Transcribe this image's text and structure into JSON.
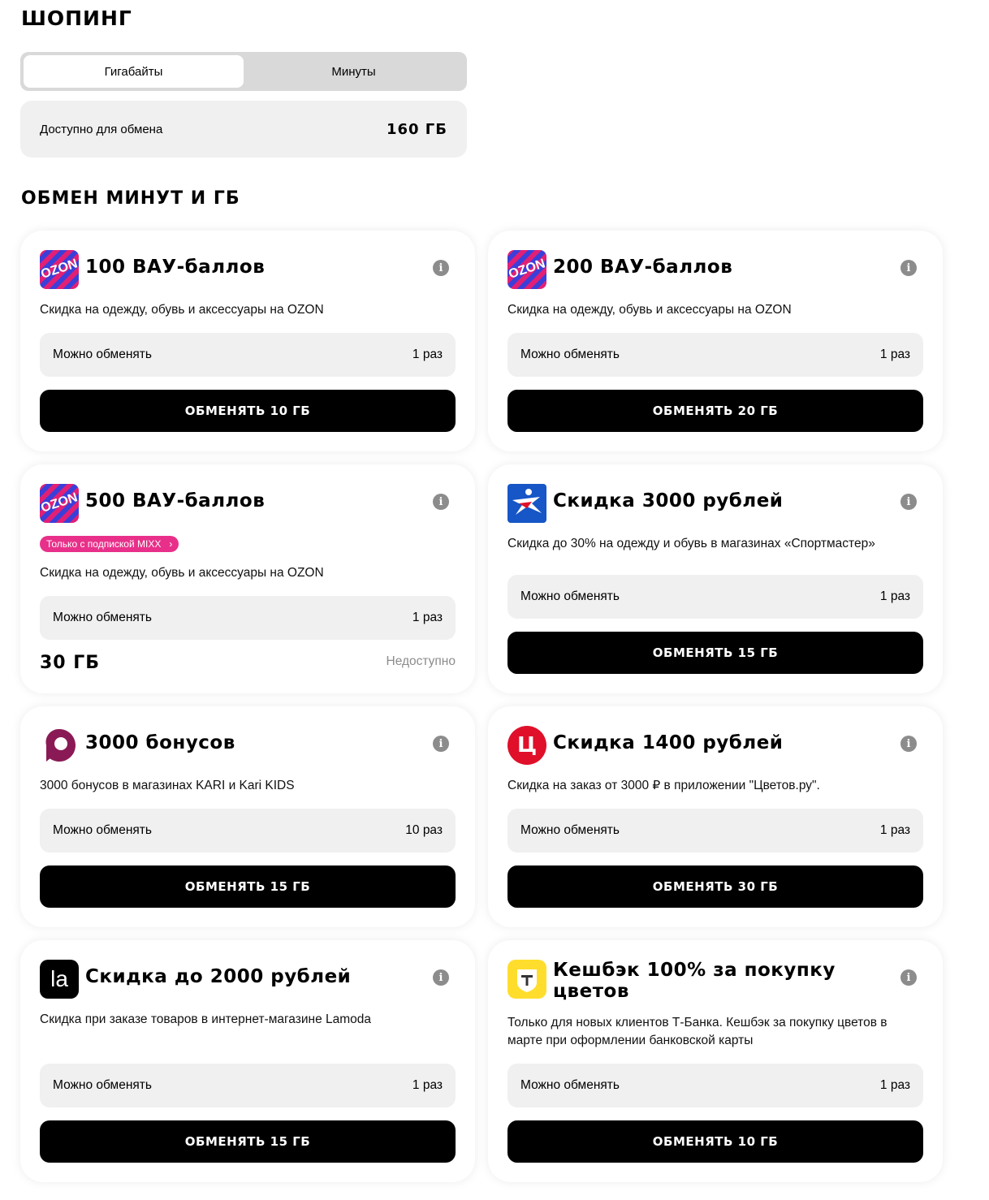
{
  "page": {
    "title": "ШОПИНГ",
    "tabs": [
      {
        "label": "Гигабайты",
        "active": true
      },
      {
        "label": "Минуты",
        "active": false
      }
    ],
    "available": {
      "label": "Доступно для обмена",
      "value": "160 ГБ"
    },
    "section_title": "ОБМЕН МИНУТ И ГБ"
  },
  "common": {
    "count_label": "Можно обменять",
    "info_glyph": "i"
  },
  "cards": [
    {
      "logo": "ozon-logo",
      "logo_text": "OZON",
      "title": "100 ВАУ-баллов",
      "desc": "Скидка на одежду, обувь и аксессуары на OZON",
      "count": "1 раз",
      "button": "ОБМЕНЯТЬ 10 ГБ"
    },
    {
      "logo": "ozon-logo",
      "logo_text": "OZON",
      "title": "200 ВАУ-баллов",
      "desc": "Скидка на одежду, обувь и аксессуары на OZON",
      "count": "1 раз",
      "button": "ОБМЕНЯТЬ 20 ГБ"
    },
    {
      "logo": "ozon-logo",
      "logo_text": "OZON",
      "title": "500 ВАУ-баллов",
      "badge": "Только с подпиской MIXX",
      "desc": "Скидка на одежду, обувь и аксессуары на OZON",
      "count": "1 раз",
      "price": "30 ГБ",
      "status": "Недоступно"
    },
    {
      "logo": "sportmaster-logo",
      "title": "Скидка 3000 рублей",
      "desc": "Скидка до 30% на одежду и обувь в магазинах «Спортмастер»",
      "count": "1 раз",
      "button": "ОБМЕНЯТЬ 15 ГБ"
    },
    {
      "logo": "kari-logo",
      "title": "3000 бонусов",
      "desc": "3000 бонусов в магазинах KARI и Kari KIDS",
      "count": "10 раз",
      "button": "ОБМЕНЯТЬ 15 ГБ"
    },
    {
      "logo": "cvetov-logo",
      "logo_text": "Ц",
      "title": "Скидка 1400 рублей",
      "desc": "Скидка на заказ от 3000 ₽ в приложении \"Цветов.ру\".",
      "count": "1 раз",
      "button": "ОБМЕНЯТЬ 30 ГБ"
    },
    {
      "logo": "lamoda-logo",
      "logo_text": "la",
      "title": "Скидка до 2000 рублей",
      "desc": "Скидка при заказе товаров в интернет-магазине Lamoda",
      "count": "1 раз",
      "button": "ОБМЕНЯТЬ 15 ГБ"
    },
    {
      "logo": "tbank-logo",
      "title": "Кешбэк 100% за покупку цветов",
      "desc": "Только для новых клиентов Т-Банка. Кешбэк за покупку цветов в марте при оформлении банковской карты",
      "count": "1 раз",
      "button": "ОБМЕНЯТЬ 10 ГБ"
    }
  ]
}
